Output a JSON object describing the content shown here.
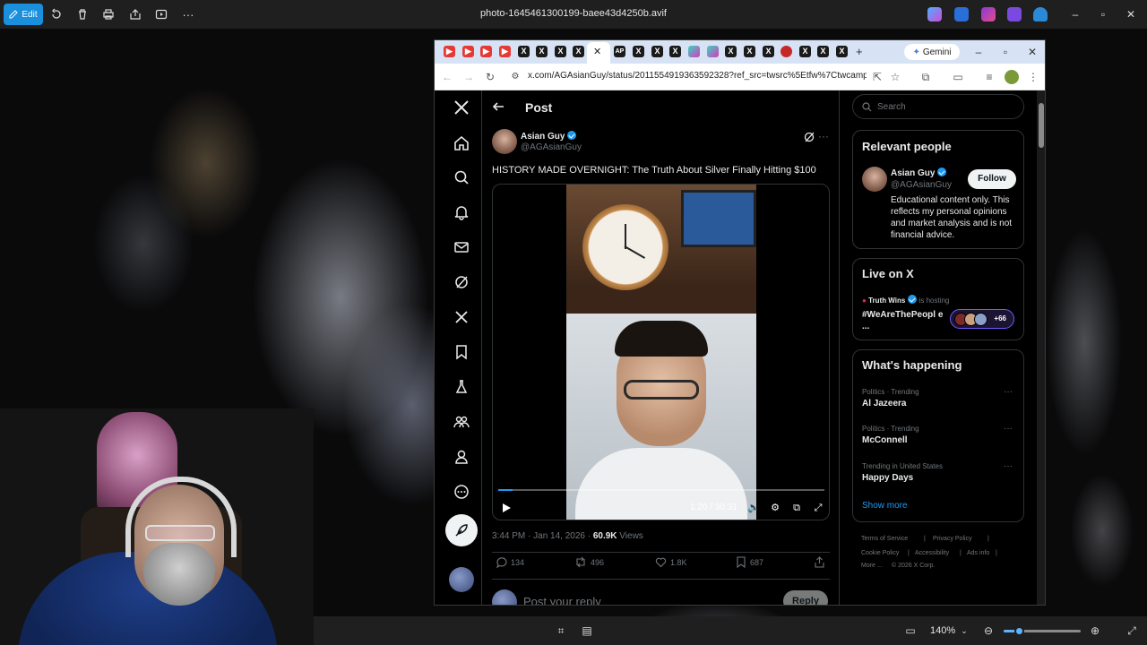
{
  "viewer": {
    "edit_label": "Edit",
    "file_title": "photo-1645461300199-baee43d4250b.avif",
    "zoom_label": "140%",
    "zoom_level": 0.2
  },
  "browser": {
    "url": "x.com/AGAsianGuy/status/2011554919363592328?ref_src=twsrc%5Etfw%7Ctwcamp%5Et...",
    "gemini_label": "Gemini",
    "new_tab_label": "+"
  },
  "post": {
    "header_title": "Post",
    "author_name": "Asian Guy",
    "author_handle": "@AGAsianGuy",
    "text": "HISTORY MADE OVERNIGHT: The Truth About Silver Finally Hitting $100",
    "video_time": "1:20 / 30:31",
    "video_progress": 0.044,
    "meta_time": "3:44 PM · Jan 14, 2026 · ",
    "meta_views_count": "60.9K",
    "meta_views_label": " Views",
    "replies": "134",
    "reposts": "496",
    "likes": "1.8K",
    "bookmarks": "687",
    "reply_placeholder": "Post your reply",
    "reply_button": "Reply"
  },
  "sidebar": {
    "search_placeholder": "Search",
    "relevant_title": "Relevant people",
    "rp_name": "Asian Guy",
    "rp_handle": "@AGAsianGuy",
    "follow_label": "Follow",
    "rp_bio": "Educational content only. This reflects my personal opinions and market analysis and is not financial advice.",
    "live_title": "Live on X",
    "live_host_name": "Truth Wins",
    "live_host_suffix": " is hosting",
    "live_topic": "#WeAreThePeopl e ...",
    "live_count": "+66",
    "happening_title": "What's happening",
    "trends": [
      {
        "category": "Politics · Trending",
        "name": "Al Jazeera"
      },
      {
        "category": "Politics · Trending",
        "name": "McConnell"
      },
      {
        "category": "Trending in United States",
        "name": "Happy Days"
      }
    ],
    "show_more": "Show more",
    "footer": {
      "terms": "Terms of Service",
      "privacy": "Privacy Policy",
      "cookie": "Cookie Policy",
      "accessibility": "Accessibility",
      "ads": "Ads info",
      "more": "More ...",
      "copyright": "© 2026 X Corp."
    }
  },
  "colors": {
    "accent": "#1d9bf0",
    "edit_button": "#1a8fdc",
    "live_border": "#7856ff"
  }
}
